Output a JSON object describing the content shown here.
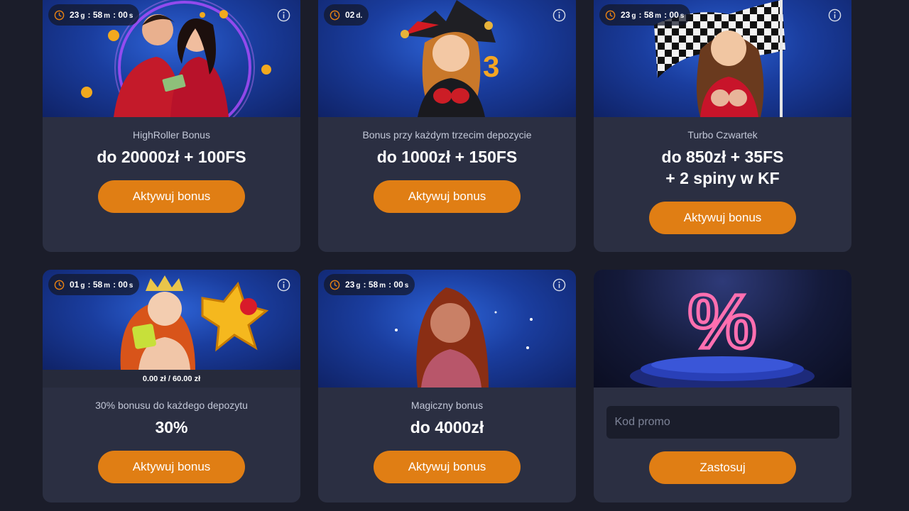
{
  "colors": {
    "background": "#1b1d2a",
    "card": "#2b2f42",
    "accent_button": "#e07e14",
    "banner_blue": "#1a3d9e",
    "text_primary": "#ffffff",
    "text_secondary": "#c3c8d8"
  },
  "cards": [
    {
      "timer": {
        "icon": "clock-icon",
        "parts": [
          "23",
          "g",
          ":",
          "58",
          "m",
          ":",
          "00",
          "s"
        ]
      },
      "info_icon": "info-icon",
      "name": "HighRoller Bonus",
      "value_lines": [
        "do 20000zł + 100FS"
      ],
      "button": "Aktywuj bonus"
    },
    {
      "timer": {
        "icon": "clock-icon",
        "parts": [
          "02",
          "d."
        ]
      },
      "info_icon": "info-icon",
      "name": "Bonus przy każdym trzecim depozycie",
      "value_lines": [
        "do 1000zł + 150FS"
      ],
      "button": "Aktywuj bonus"
    },
    {
      "timer": {
        "icon": "clock-icon",
        "parts": [
          "23",
          "g",
          ":",
          "58",
          "m",
          ":",
          "00",
          "s"
        ]
      },
      "info_icon": "info-icon",
      "name": "Turbo Czwartek",
      "value_lines": [
        "do 850zł + 35FS",
        "+ 2 spiny w KF"
      ],
      "button": "Aktywuj bonus"
    },
    {
      "timer": {
        "icon": "clock-icon",
        "parts": [
          "01",
          "g",
          ":",
          "58",
          "m",
          ":",
          "00",
          "s"
        ]
      },
      "info_icon": "info-icon",
      "progress": {
        "text": "0.00 zł / 60.00 zł",
        "fraction": 0
      },
      "name": "30% bonusu do każdego depozytu",
      "value_lines": [
        "30%"
      ],
      "button": "Aktywuj bonus"
    },
    {
      "timer": {
        "icon": "clock-icon",
        "parts": [
          "23",
          "g",
          ":",
          "58",
          "m",
          ":",
          "00",
          "s"
        ]
      },
      "info_icon": "info-icon",
      "name": "Magiczny bonus",
      "value_lines": [
        "do 4000zł"
      ],
      "button": "Aktywuj bonus"
    }
  ],
  "promo": {
    "image_icon": "percent-icon",
    "placeholder": "Kod promo",
    "button": "Zastosuj"
  }
}
